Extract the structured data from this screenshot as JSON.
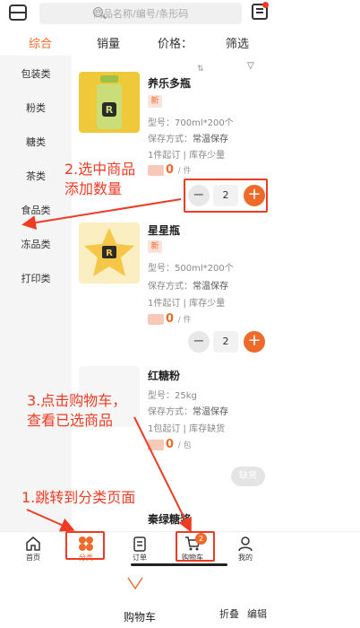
{
  "header": {
    "scan_icon": "scan-icon",
    "search_placeholder": "商品名称/编号/条形码",
    "message_icon": "message-icon"
  },
  "sort_tabs": [
    {
      "label": "综合",
      "active": true
    },
    {
      "label": "销量",
      "active": false
    },
    {
      "label": "价格：",
      "active": false
    },
    {
      "label": "筛选",
      "active": false
    }
  ],
  "categories": [
    "包装类",
    "粉类",
    "糖类",
    "茶类",
    "食品类",
    "冻品类",
    "打印类"
  ],
  "products": [
    {
      "name": "养乐多瓶",
      "badge": "新",
      "spec": "型号：700ml*200个",
      "storage_label": "保存方式：",
      "storage": "常温保存",
      "moq": "1件起订",
      "stock": "库存少量",
      "price": "0",
      "unit": "/ 件",
      "qty": "2"
    },
    {
      "name": "星星瓶",
      "badge": "新",
      "spec": "型号：500ml*200个",
      "storage_label": "保存方式：",
      "storage": "常温保存",
      "moq": "1件起订",
      "stock": "库存少量",
      "price": "0",
      "unit": "/ 件",
      "qty": "2"
    },
    {
      "name": "红糖粉",
      "spec": "型号：25kg",
      "storage_label": "保存方式：",
      "storage": "常温保存",
      "moq": "1包起订",
      "stock": "库存缺货",
      "price": "0",
      "unit": "/ 包",
      "soldout": "缺货"
    },
    {
      "name": "秦绿糖浆"
    }
  ],
  "bottom_nav": [
    {
      "label": "首页",
      "icon": "home-icon"
    },
    {
      "label": "分类",
      "icon": "category-icon",
      "active": true
    },
    {
      "label": "订单",
      "icon": "order-icon"
    },
    {
      "label": "购物车",
      "icon": "cart-icon",
      "badge": "2"
    },
    {
      "label": "我的",
      "icon": "user-icon"
    }
  ],
  "cart_drawer": {
    "title": "购物车",
    "fold": "折叠",
    "edit": "编辑"
  },
  "annotations": {
    "step1": "1.跳转到分类页面",
    "step2_line1": "2.选中商品",
    "step2_line2": "添加数量",
    "step3_line1": "3.点击购物车，",
    "step3_line2": "查看已选商品"
  },
  "colors": {
    "accent": "#ee6a2b",
    "annotation": "#ee3b24"
  }
}
